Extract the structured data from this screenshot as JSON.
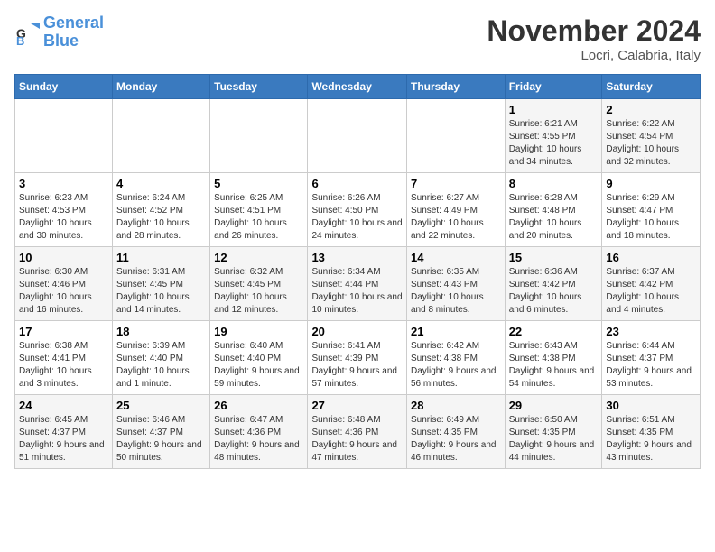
{
  "header": {
    "logo_line1": "General",
    "logo_line2": "Blue",
    "month_title": "November 2024",
    "location": "Locri, Calabria, Italy"
  },
  "days_of_week": [
    "Sunday",
    "Monday",
    "Tuesday",
    "Wednesday",
    "Thursday",
    "Friday",
    "Saturday"
  ],
  "weeks": [
    [
      {
        "day": "",
        "info": ""
      },
      {
        "day": "",
        "info": ""
      },
      {
        "day": "",
        "info": ""
      },
      {
        "day": "",
        "info": ""
      },
      {
        "day": "",
        "info": ""
      },
      {
        "day": "1",
        "info": "Sunrise: 6:21 AM\nSunset: 4:55 PM\nDaylight: 10 hours and 34 minutes."
      },
      {
        "day": "2",
        "info": "Sunrise: 6:22 AM\nSunset: 4:54 PM\nDaylight: 10 hours and 32 minutes."
      }
    ],
    [
      {
        "day": "3",
        "info": "Sunrise: 6:23 AM\nSunset: 4:53 PM\nDaylight: 10 hours and 30 minutes."
      },
      {
        "day": "4",
        "info": "Sunrise: 6:24 AM\nSunset: 4:52 PM\nDaylight: 10 hours and 28 minutes."
      },
      {
        "day": "5",
        "info": "Sunrise: 6:25 AM\nSunset: 4:51 PM\nDaylight: 10 hours and 26 minutes."
      },
      {
        "day": "6",
        "info": "Sunrise: 6:26 AM\nSunset: 4:50 PM\nDaylight: 10 hours and 24 minutes."
      },
      {
        "day": "7",
        "info": "Sunrise: 6:27 AM\nSunset: 4:49 PM\nDaylight: 10 hours and 22 minutes."
      },
      {
        "day": "8",
        "info": "Sunrise: 6:28 AM\nSunset: 4:48 PM\nDaylight: 10 hours and 20 minutes."
      },
      {
        "day": "9",
        "info": "Sunrise: 6:29 AM\nSunset: 4:47 PM\nDaylight: 10 hours and 18 minutes."
      }
    ],
    [
      {
        "day": "10",
        "info": "Sunrise: 6:30 AM\nSunset: 4:46 PM\nDaylight: 10 hours and 16 minutes."
      },
      {
        "day": "11",
        "info": "Sunrise: 6:31 AM\nSunset: 4:45 PM\nDaylight: 10 hours and 14 minutes."
      },
      {
        "day": "12",
        "info": "Sunrise: 6:32 AM\nSunset: 4:45 PM\nDaylight: 10 hours and 12 minutes."
      },
      {
        "day": "13",
        "info": "Sunrise: 6:34 AM\nSunset: 4:44 PM\nDaylight: 10 hours and 10 minutes."
      },
      {
        "day": "14",
        "info": "Sunrise: 6:35 AM\nSunset: 4:43 PM\nDaylight: 10 hours and 8 minutes."
      },
      {
        "day": "15",
        "info": "Sunrise: 6:36 AM\nSunset: 4:42 PM\nDaylight: 10 hours and 6 minutes."
      },
      {
        "day": "16",
        "info": "Sunrise: 6:37 AM\nSunset: 4:42 PM\nDaylight: 10 hours and 4 minutes."
      }
    ],
    [
      {
        "day": "17",
        "info": "Sunrise: 6:38 AM\nSunset: 4:41 PM\nDaylight: 10 hours and 3 minutes."
      },
      {
        "day": "18",
        "info": "Sunrise: 6:39 AM\nSunset: 4:40 PM\nDaylight: 10 hours and 1 minute."
      },
      {
        "day": "19",
        "info": "Sunrise: 6:40 AM\nSunset: 4:40 PM\nDaylight: 9 hours and 59 minutes."
      },
      {
        "day": "20",
        "info": "Sunrise: 6:41 AM\nSunset: 4:39 PM\nDaylight: 9 hours and 57 minutes."
      },
      {
        "day": "21",
        "info": "Sunrise: 6:42 AM\nSunset: 4:38 PM\nDaylight: 9 hours and 56 minutes."
      },
      {
        "day": "22",
        "info": "Sunrise: 6:43 AM\nSunset: 4:38 PM\nDaylight: 9 hours and 54 minutes."
      },
      {
        "day": "23",
        "info": "Sunrise: 6:44 AM\nSunset: 4:37 PM\nDaylight: 9 hours and 53 minutes."
      }
    ],
    [
      {
        "day": "24",
        "info": "Sunrise: 6:45 AM\nSunset: 4:37 PM\nDaylight: 9 hours and 51 minutes."
      },
      {
        "day": "25",
        "info": "Sunrise: 6:46 AM\nSunset: 4:37 PM\nDaylight: 9 hours and 50 minutes."
      },
      {
        "day": "26",
        "info": "Sunrise: 6:47 AM\nSunset: 4:36 PM\nDaylight: 9 hours and 48 minutes."
      },
      {
        "day": "27",
        "info": "Sunrise: 6:48 AM\nSunset: 4:36 PM\nDaylight: 9 hours and 47 minutes."
      },
      {
        "day": "28",
        "info": "Sunrise: 6:49 AM\nSunset: 4:35 PM\nDaylight: 9 hours and 46 minutes."
      },
      {
        "day": "29",
        "info": "Sunrise: 6:50 AM\nSunset: 4:35 PM\nDaylight: 9 hours and 44 minutes."
      },
      {
        "day": "30",
        "info": "Sunrise: 6:51 AM\nSunset: 4:35 PM\nDaylight: 9 hours and 43 minutes."
      }
    ]
  ]
}
